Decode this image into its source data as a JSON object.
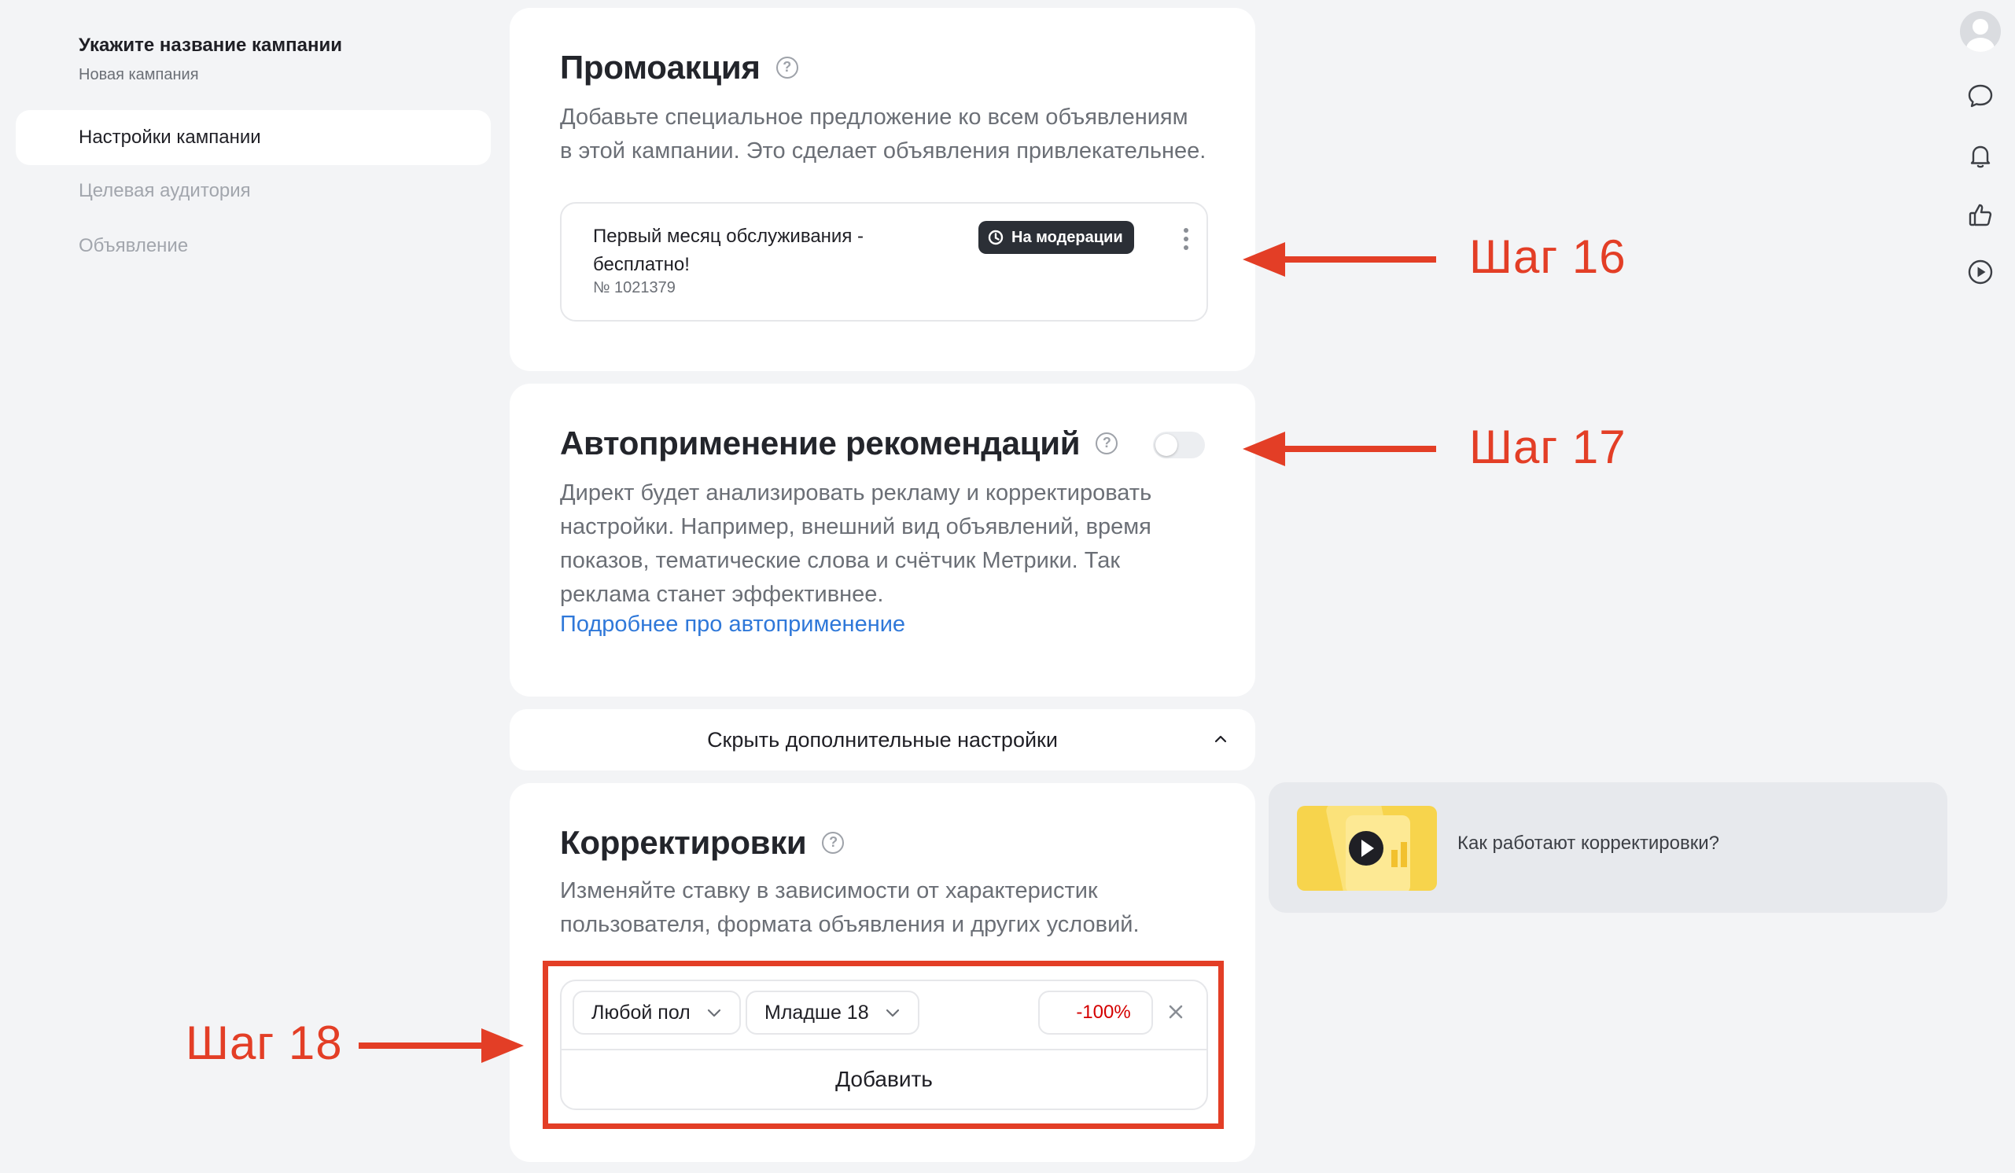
{
  "sidebar": {
    "campaign_title": "Укажите название кампании",
    "campaign_subtitle": "Новая кампания",
    "nav": [
      {
        "label": "Настройки кампании",
        "active": true
      },
      {
        "label": "Целевая аудитория",
        "active": false
      },
      {
        "label": "Объявление",
        "active": false
      }
    ]
  },
  "promo": {
    "title": "Промоакция",
    "description_line1": "Добавьте специальное предложение ко всем объявлениям",
    "description_line2": "в этой кампании. Это сделает объявления привлекательнее.",
    "item": {
      "name_line1": "Первый месяц обслуживания -",
      "name_line2": "бесплатно!",
      "number": "№ 1021379",
      "status": "На модерации"
    }
  },
  "autoapply": {
    "title": "Автоприменение рекомендаций",
    "enabled": false,
    "description_lines": [
      "Директ будет анализировать рекламу и корректировать",
      "настройки. Например, внешний вид объявлений, время",
      "показов, тематические слова и счётчик Метрики. Так",
      "реклама станет эффективнее."
    ],
    "link": "Подробнее про автоприменение"
  },
  "hide_settings": {
    "label": "Скрыть дополнительные настройки"
  },
  "adjustments": {
    "title": "Корректировки",
    "description_line1": "Изменяйте ставку в зависимости от характеристик",
    "description_line2": "пользователя, формата объявления и других условий.",
    "row": {
      "gender": "Любой пол",
      "age": "Младше 18",
      "value": "-100%"
    },
    "add_label": "Добавить"
  },
  "video": {
    "label": "Как работают корректировки?"
  },
  "steps": {
    "s16": "Шаг 16",
    "s17": "Шаг 17",
    "s18": "Шаг 18"
  },
  "colors": {
    "annotation": "#e33e26",
    "link": "#2f78d9",
    "negative_value": "#d40000",
    "badge_bg": "#2b2f36"
  },
  "icons": [
    "help-circle-icon",
    "clock-icon",
    "kebab-menu-icon",
    "chevron-up-icon",
    "chevron-down-icon",
    "close-icon",
    "play-icon",
    "avatar-icon",
    "chat-icon",
    "bell-icon",
    "thumbs-up-icon",
    "play-circle-icon"
  ]
}
